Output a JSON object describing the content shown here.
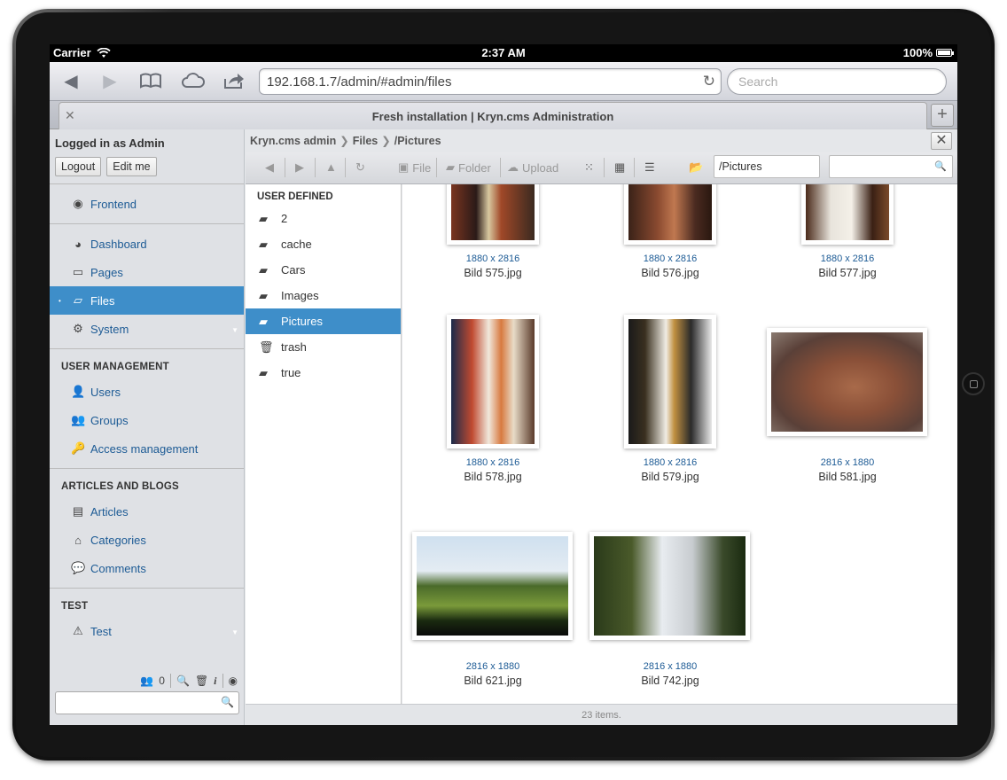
{
  "status": {
    "carrier": "Carrier",
    "time": "2:37 AM",
    "battery": "100%"
  },
  "browser": {
    "url": "192.168.1.7/admin/#admin/files",
    "search_placeholder": "Search",
    "tab_title": "Fresh installation | Kryn.cms Administration"
  },
  "sidebar": {
    "login_title": "Logged in as Admin",
    "logout_label": "Logout",
    "editme_label": "Edit me",
    "group0": [
      {
        "label": "Frontend",
        "icon": "eye-icon"
      }
    ],
    "group1": [
      {
        "label": "Dashboard",
        "icon": "dashboard-icon"
      },
      {
        "label": "Pages",
        "icon": "monitor-icon"
      },
      {
        "label": "Files",
        "icon": "folder-icon"
      },
      {
        "label": "System",
        "icon": "gear-icon"
      }
    ],
    "user_mgmt_title": "USER MANAGEMENT",
    "user_mgmt": [
      {
        "label": "Users",
        "icon": "user-icon"
      },
      {
        "label": "Groups",
        "icon": "group-icon"
      },
      {
        "label": "Access management",
        "icon": "key-icon"
      }
    ],
    "articles_title": "ARTICLES AND BLOGS",
    "articles": [
      {
        "label": "Articles",
        "icon": "articles-icon"
      },
      {
        "label": "Categories",
        "icon": "categories-icon"
      },
      {
        "label": "Comments",
        "icon": "comments-icon"
      }
    ],
    "test_title": "TEST",
    "test": [
      {
        "label": "Test",
        "icon": "warning-icon"
      }
    ],
    "online_count": "0"
  },
  "files": {
    "breadcrumb": [
      "Kryn.cms admin",
      "Files",
      "/Pictures"
    ],
    "toolbar": {
      "file": "File",
      "folder": "Folder",
      "upload": "Upload"
    },
    "path_value": "/Pictures",
    "tree_title": "USER DEFINED",
    "tree": [
      {
        "label": "2",
        "icon": "folder-icon"
      },
      {
        "label": "cache",
        "icon": "folder-icon"
      },
      {
        "label": "Cars",
        "icon": "folder-icon"
      },
      {
        "label": "Images",
        "icon": "folder-icon"
      },
      {
        "label": "Pictures",
        "icon": "folder-open-icon"
      },
      {
        "label": "trash",
        "icon": "trash-icon"
      },
      {
        "label": "true",
        "icon": "folder-icon"
      }
    ],
    "items": [
      {
        "dim": "1880 x 2816",
        "name": "Bild 575.jpg"
      },
      {
        "dim": "1880 x 2816",
        "name": "Bild 576.jpg"
      },
      {
        "dim": "1880 x 2816",
        "name": "Bild 577.jpg"
      },
      {
        "dim": "1880 x 2816",
        "name": "Bild 578.jpg"
      },
      {
        "dim": "1880 x 2816",
        "name": "Bild 579.jpg"
      },
      {
        "dim": "2816 x 1880",
        "name": "Bild 581.jpg"
      },
      {
        "dim": "2816 x 1880",
        "name": "Bild 621.jpg"
      },
      {
        "dim": "2816 x 1880",
        "name": "Bild 742.jpg"
      }
    ],
    "count_text": "23 items."
  }
}
